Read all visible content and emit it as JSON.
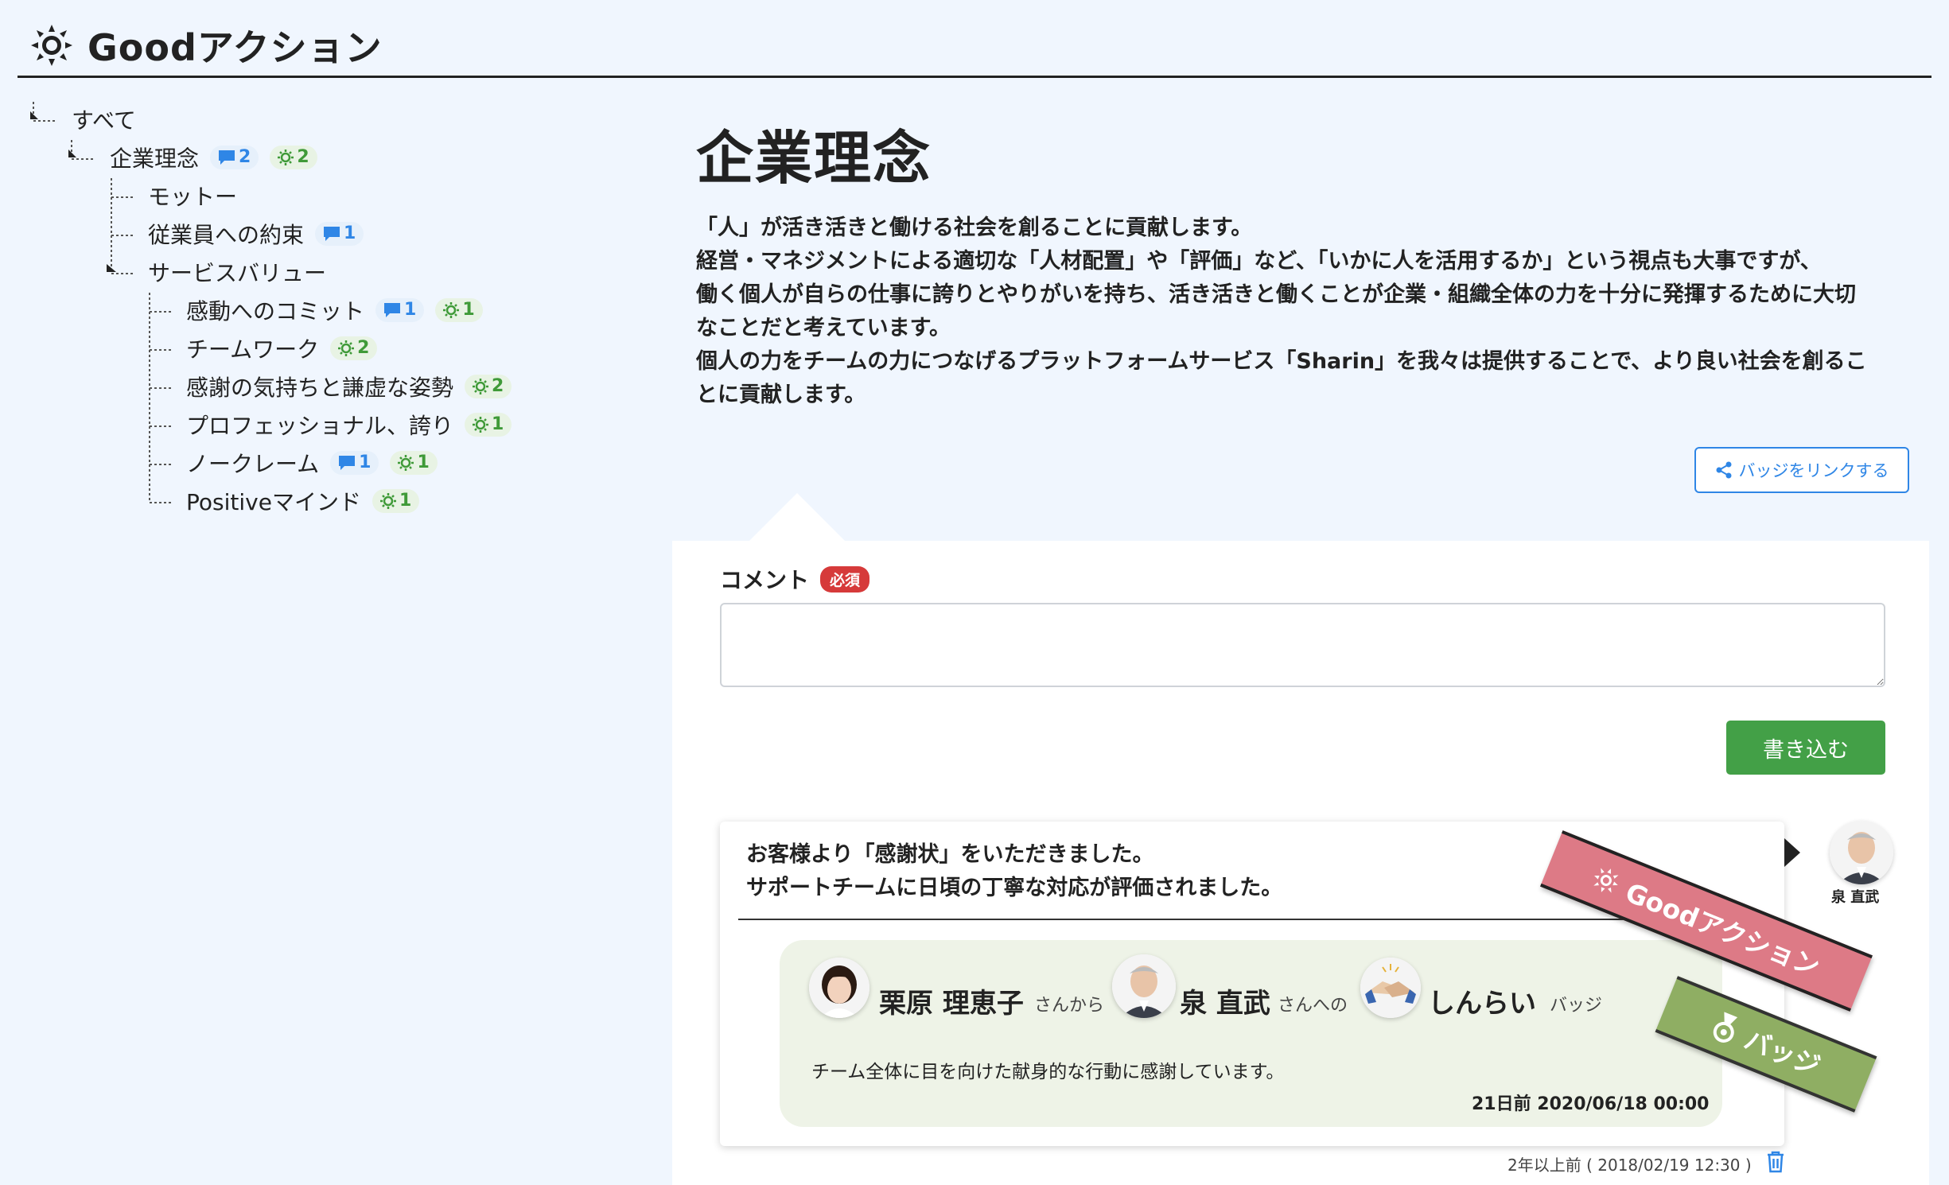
{
  "app": {
    "title": "Goodアクション",
    "icon": "sun-icon"
  },
  "tree": {
    "items": [
      {
        "label": "すべて",
        "level": 0
      },
      {
        "label": "企業理念",
        "level": 1,
        "comments": "2",
        "goods": "2"
      },
      {
        "label": "モットー",
        "level": 2
      },
      {
        "label": "従業員への約束",
        "level": 2,
        "comments": "1"
      },
      {
        "label": "サービスバリュー",
        "level": 2
      },
      {
        "label": "感動へのコミット",
        "level": 3,
        "comments": "1",
        "goods": "1"
      },
      {
        "label": "チームワーク",
        "level": 3,
        "goods": "2"
      },
      {
        "label": "感謝の気持ちと謙虚な姿勢",
        "level": 3,
        "goods": "2"
      },
      {
        "label": "プロフェッショナル、誇り",
        "level": 3,
        "goods": "1"
      },
      {
        "label": "ノークレーム",
        "level": 3,
        "comments": "1",
        "goods": "1"
      },
      {
        "label": "Positiveマインド",
        "level": 3,
        "goods": "1"
      }
    ]
  },
  "main": {
    "title": "企業理念",
    "description": [
      "「人」が活き活きと働ける社会を創ることに貢献します。",
      "経営・マネジメントによる適切な「人材配置」や「評価」など、「いかに人を活用するか」という視点も大事ですが、",
      "働く個人が自らの仕事に誇りとやりがいを持ち、活き活きと働くことが企業・組織全体の力を十分に発揮するために大切",
      "なことだと考えています。",
      "個人の力をチームの力につなげるプラットフォームサービス「Sharin」を我々は提供することで、より良い社会を創るこ",
      "とに貢献します。"
    ],
    "link_badge_button": "バッジをリンクする"
  },
  "comment_form": {
    "label": "コメント",
    "required": "必須",
    "value": "",
    "submit": "書き込む"
  },
  "post": {
    "text_lines": [
      "お客様より「感謝状」をいただきました。",
      "サポートチームに日頃の丁寧な対応が評価されました。"
    ],
    "poster_name": "泉 直武",
    "badge": {
      "from_name": "栗原 理恵子",
      "from_suffix": "さんから",
      "to_name": "泉 直武",
      "to_suffix": "さんへの",
      "badge_name": "しんらい",
      "badge_suffix": "バッジ",
      "message": "チーム全体に目を向けた献身的な行動に感謝しています。",
      "date": "21日前 2020/06/18 00:00"
    },
    "posted_at": "2年以上前 ( 2018/02/19 12:30 )",
    "ribbon_good": "Goodアクション",
    "ribbon_badge": "バッジ"
  },
  "colors": {
    "accent_blue": "#2f86e6",
    "good_green": "#3f9a38",
    "submit_green": "#43a047",
    "required_red": "#d63a3a",
    "ribbon_pink": "#dd7a86",
    "ribbon_green": "#8fae63"
  }
}
